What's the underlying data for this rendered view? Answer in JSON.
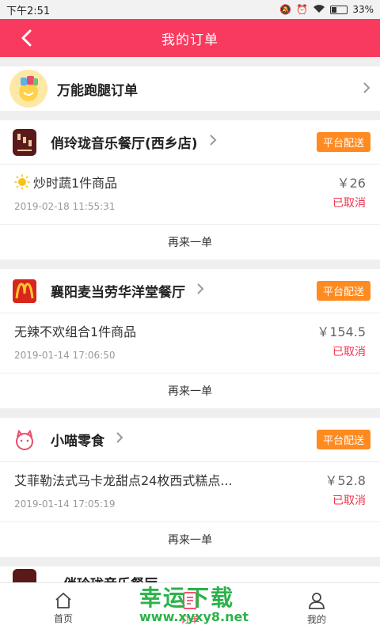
{
  "status_bar": {
    "time": "下午2:51",
    "battery": "33%"
  },
  "header": {
    "title": "我的订单"
  },
  "errand": {
    "label": "万能跑腿订单"
  },
  "orders": [
    {
      "shop": "俏玲珑音乐餐厅(西乡店)",
      "badge": "平台配送",
      "item": "炒时蔬1件商品",
      "time": "2019-02-18 11:55:31",
      "price": "￥26",
      "status": "已取消",
      "action": "再来一单"
    },
    {
      "shop": "襄阳麦当劳华洋堂餐厅",
      "badge": "平台配送",
      "item": "无辣不欢组合1件商品",
      "time": "2019-01-14 17:06:50",
      "price": "￥154.5",
      "status": "已取消",
      "action": "再来一单"
    },
    {
      "shop": "小喵零食",
      "badge": "平台配送",
      "item": "艾菲勒法式马卡龙甜点24枚西式糕点...",
      "time": "2019-01-14 17:05:19",
      "price": "￥52.8",
      "status": "已取消",
      "action": "再来一单"
    }
  ],
  "partial_order": {
    "shop": "俏玲珑音乐餐厅"
  },
  "tabs": [
    {
      "label": "首页"
    },
    {
      "label": "订单"
    },
    {
      "label": "我的"
    }
  ],
  "watermark": {
    "main": "幸运下载",
    "url": "www.xyxy8.net"
  },
  "colors": {
    "accent": "#f83a5e",
    "badge": "#ff8a1f",
    "cancelled": "#f0344f"
  }
}
